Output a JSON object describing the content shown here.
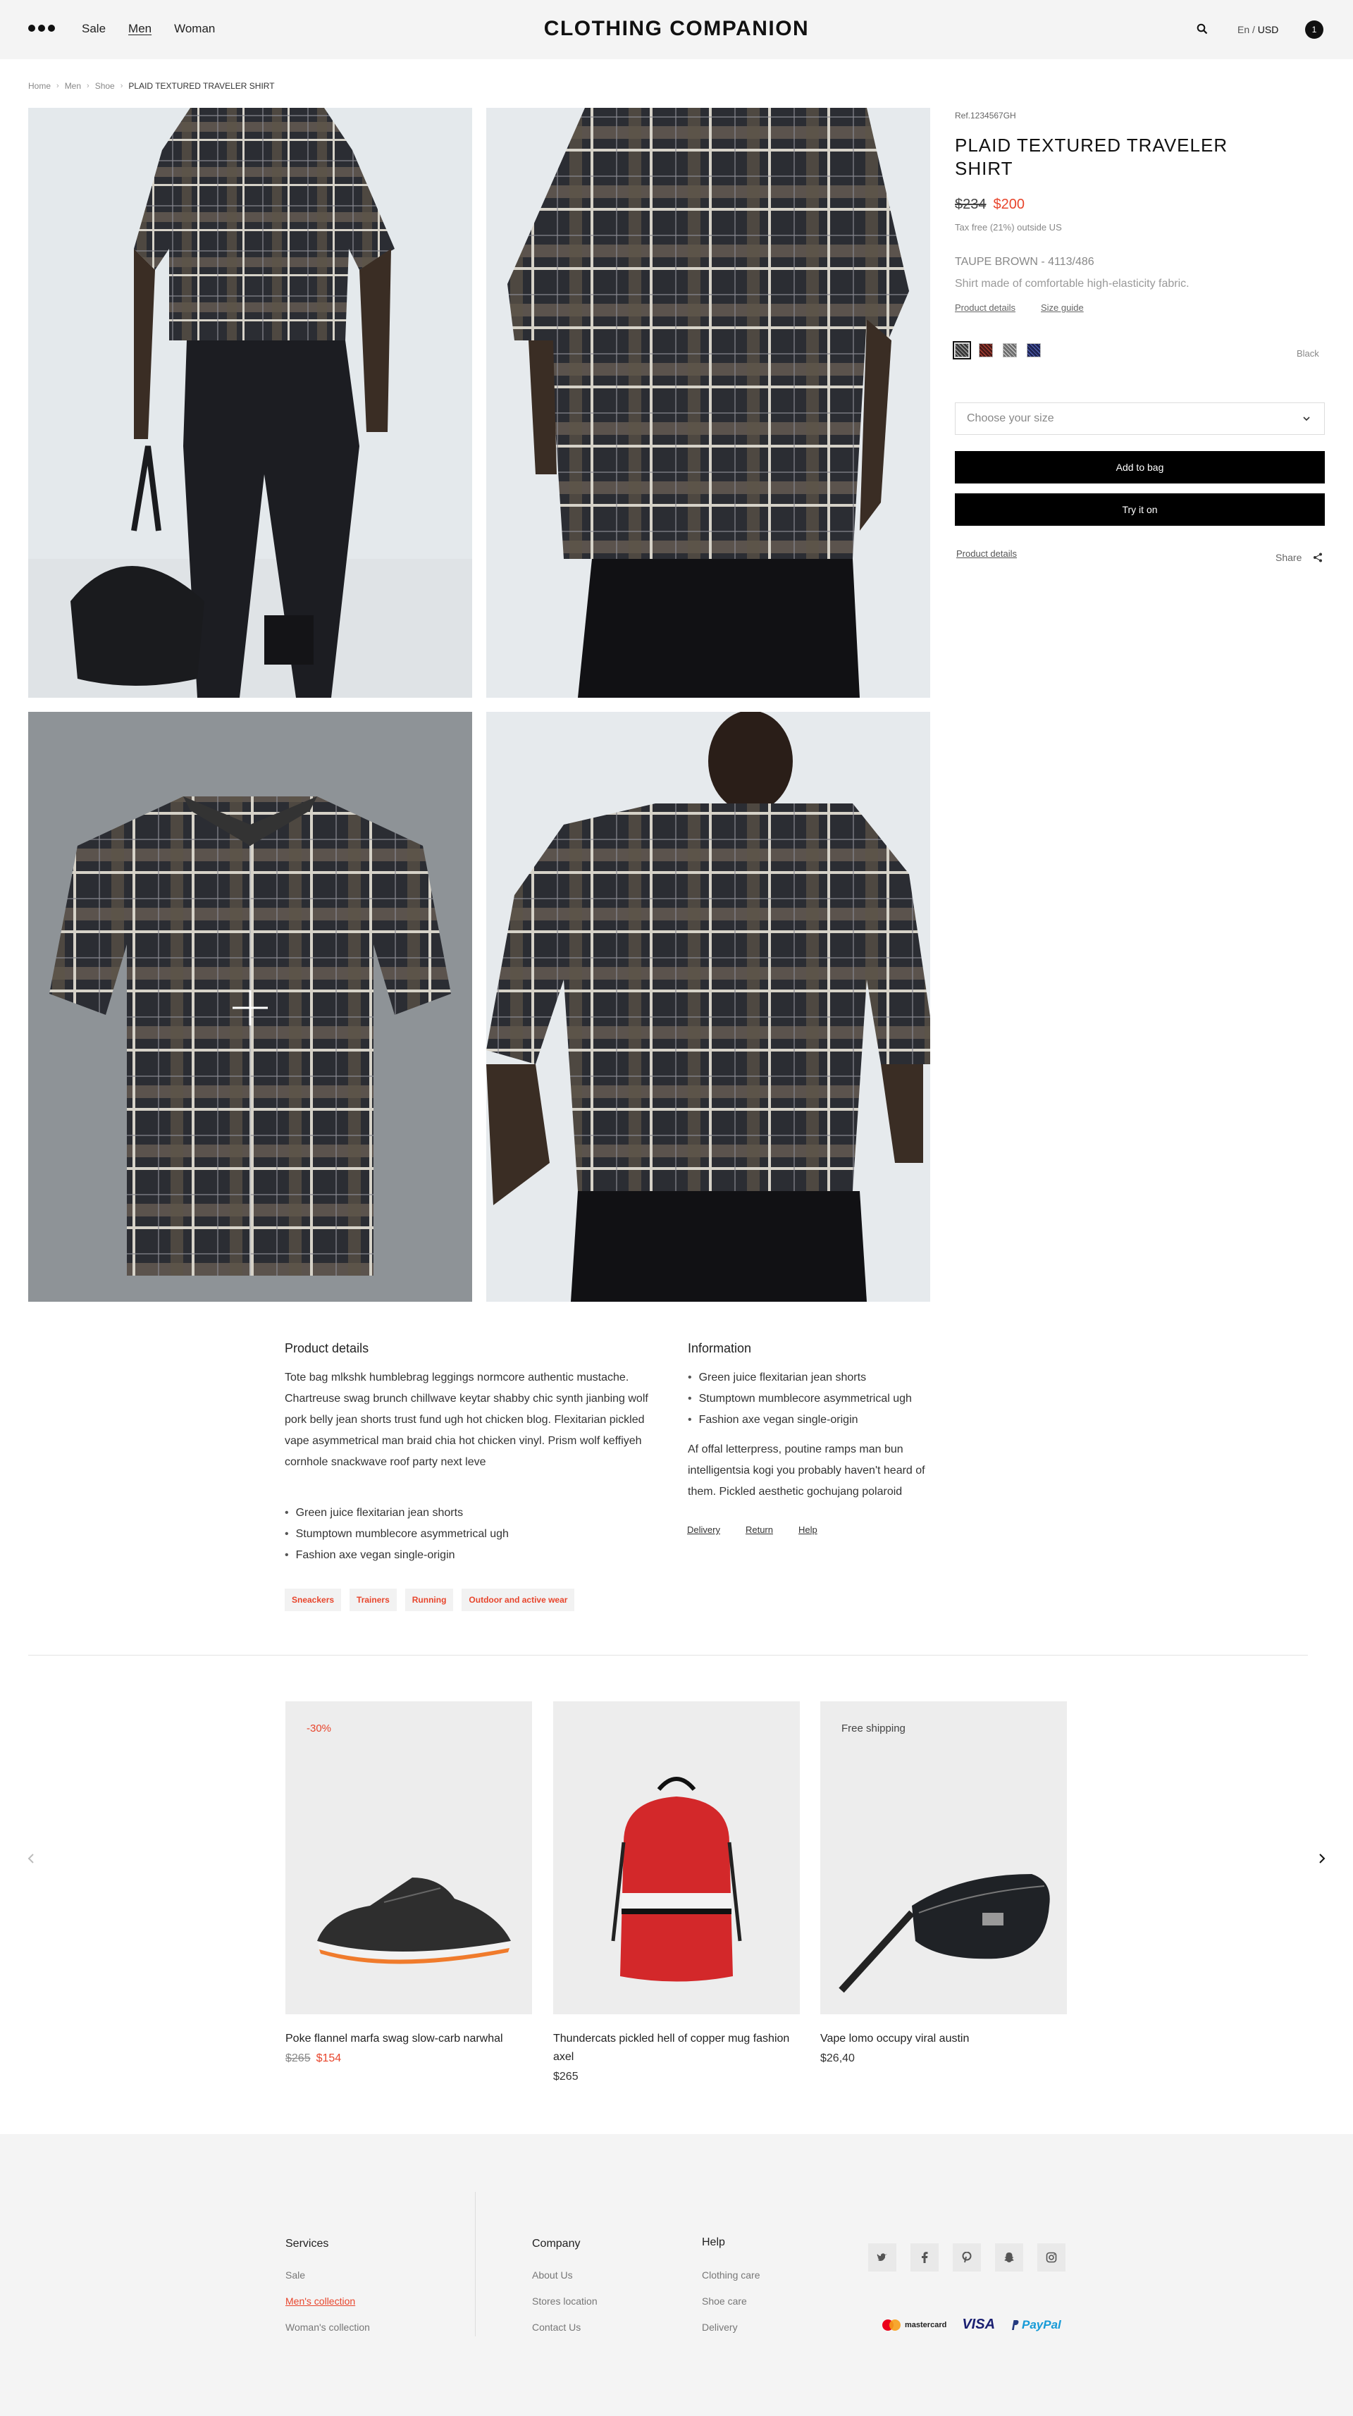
{
  "header": {
    "brand": "CLOTHING COMPANION",
    "nav": [
      "Sale",
      "Men",
      "Woman"
    ],
    "lang": "En",
    "currency": "USD",
    "lang_sep": " / ",
    "cart_count": "1"
  },
  "breadcrumb": [
    "Home",
    "Men",
    "Shoe",
    "PLAID TEXTURED TRAVELER SHIRT"
  ],
  "product": {
    "ref": "Ref.1234567GH",
    "title": "PLAID TEXTURED TRAVELER SHIRT",
    "old_price": "$234",
    "price": "$200",
    "tax_note": "Tax free (21%) outside US",
    "color_code": "TAUPE BROWN - 4113/486",
    "description": "Shirt made of comfortable high-elasticity fabric.",
    "links": [
      "Product details",
      "Size guide"
    ],
    "swatch_colors": [
      "#3a3a3a",
      "#4a1a18",
      "#6e6e6e",
      "#1e2452"
    ],
    "selected_color": "Black",
    "size_placeholder": "Choose your size",
    "add_to_bag": "Add to bag",
    "try_on": "Try it on",
    "details_link": "Product details",
    "share": "Share"
  },
  "details": {
    "title": "Product details",
    "text": "Tote bag mlkshk humblebrag leggings normcore authentic mustache. Chartreuse swag brunch chillwave keytar shabby chic synth jianbing wolf pork belly jean shorts trust fund ugh hot chicken blog. Flexitarian pickled vape asymmetrical man braid chia hot chicken vinyl. Prism wolf keffiyeh cornhole snackwave roof party next leve",
    "bullets": [
      "Green juice flexitarian jean shorts",
      "Stumptown mumblecore asymmetrical ugh",
      "Fashion axe vegan single-origin"
    ],
    "tags": [
      "Sneackers",
      "Trainers",
      "Running",
      "Outdoor and active wear"
    ]
  },
  "information": {
    "title": "Information",
    "bullets": [
      "Green juice flexitarian jean shorts",
      "Stumptown mumblecore asymmetrical ugh",
      "Fashion axe vegan single-origin"
    ],
    "text": "Af offal letterpress, poutine ramps man bun intelligentsia kogi you probably haven't heard of them. Pickled aesthetic gochujang polaroid",
    "links": [
      "Delivery",
      "Return",
      "Help"
    ]
  },
  "carousel": [
    {
      "badge": "-30%",
      "name": "Poke flannel marfa swag slow-carb narwhal",
      "old_price": "$265",
      "price": "$154"
    },
    {
      "badge": "",
      "name": "Thundercats pickled hell of copper mug fashion axel",
      "old_price": "",
      "price": "$265"
    },
    {
      "badge": "Free shipping",
      "name": "Vape lomo occupy viral austin",
      "old_price": "",
      "price": "$26,40"
    }
  ],
  "footer": {
    "services": {
      "title": "Services",
      "links": [
        "Sale",
        "Men's collection",
        "Woman's collection"
      ]
    },
    "company": {
      "title": "Company",
      "links": [
        "About Us",
        "Stores location",
        "Contact Us"
      ]
    },
    "help": {
      "title": "Help",
      "links": [
        "Clothing care",
        "Shoe care",
        "Delivery"
      ]
    },
    "socials": [
      "twitter-icon",
      "facebook-icon",
      "pinterest-icon",
      "snapchat-icon",
      "instagram-icon"
    ],
    "payments": [
      "mastercard",
      "VISA",
      "PayPal"
    ]
  },
  "colors": {
    "accent": "#e8452c",
    "header_bg": "#f4f4f4",
    "button": "#000000"
  }
}
